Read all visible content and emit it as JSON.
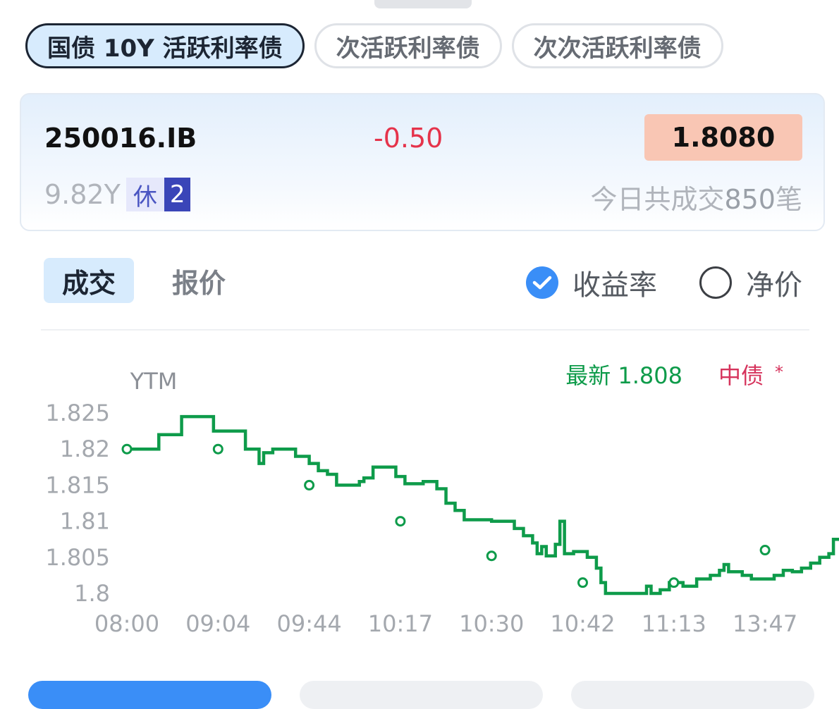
{
  "tabs": [
    {
      "label": "国债 10Y 活跃利率债",
      "active": true
    },
    {
      "label": "次活跃利率债",
      "active": false
    },
    {
      "label": "次次活跃利率债",
      "active": false
    }
  ],
  "bond": {
    "code": "250016.IB",
    "change": "-0.50",
    "price": "1.8080",
    "tenor": "9.82Y",
    "status_badge": "休",
    "status_count": "2",
    "deals_prefix": "今日共成交",
    "deals_count": "850",
    "deals_suffix": "笔"
  },
  "segments": {
    "trade": "成交",
    "quote": "报价"
  },
  "radios": {
    "yield": {
      "label": "收益率",
      "checked": true
    },
    "net_price": {
      "label": "净价",
      "checked": false
    }
  },
  "colors": {
    "line": "#0e9b4a",
    "down": "#e5334b",
    "accent": "#3a8ef7",
    "cdb": "#d6335c"
  },
  "legend": {
    "latest_label": "最新 1.808",
    "cdb_label": "中债",
    "cdb_star": "*"
  },
  "chart_data": {
    "type": "line",
    "ylabel": "YTM",
    "ylim": [
      1.8,
      1.825
    ],
    "yticks": [
      "1.825",
      "1.82",
      "1.815",
      "1.81",
      "1.805",
      "1.8"
    ],
    "xticks": [
      "08:00",
      "09:04",
      "09:44",
      "10:17",
      "10:30",
      "10:42",
      "11:13",
      "13:47"
    ],
    "series": [
      {
        "name": "成交",
        "step": true,
        "points": [
          [
            0.0,
            1.82
          ],
          [
            0.3,
            1.82
          ],
          [
            0.35,
            1.822
          ],
          [
            0.55,
            1.822
          ],
          [
            0.6,
            1.8245
          ],
          [
            0.9,
            1.8245
          ],
          [
            0.95,
            1.8225
          ],
          [
            1.1,
            1.8225
          ],
          [
            1.25,
            1.8225
          ],
          [
            1.3,
            1.82
          ],
          [
            1.45,
            1.818
          ],
          [
            1.5,
            1.8195
          ],
          [
            1.6,
            1.82
          ],
          [
            1.8,
            1.82
          ],
          [
            1.85,
            1.819
          ],
          [
            2.0,
            1.818
          ],
          [
            2.1,
            1.817
          ],
          [
            2.2,
            1.8165
          ],
          [
            2.3,
            1.815
          ],
          [
            2.5,
            1.815
          ],
          [
            2.55,
            1.8155
          ],
          [
            2.6,
            1.816
          ],
          [
            2.7,
            1.8175
          ],
          [
            2.9,
            1.8175
          ],
          [
            2.95,
            1.8162
          ],
          [
            3.05,
            1.8152
          ],
          [
            3.15,
            1.8152
          ],
          [
            3.25,
            1.8155
          ],
          [
            3.4,
            1.8145
          ],
          [
            3.5,
            1.8125
          ],
          [
            3.6,
            1.8115
          ],
          [
            3.7,
            1.8102
          ],
          [
            4.0,
            1.81
          ],
          [
            4.1,
            1.81
          ],
          [
            4.25,
            1.809
          ],
          [
            4.35,
            1.808
          ],
          [
            4.45,
            1.807
          ],
          [
            4.5,
            1.8055
          ],
          [
            4.55,
            1.8065
          ],
          [
            4.6,
            1.8052
          ],
          [
            4.7,
            1.8068
          ],
          [
            4.75,
            1.81
          ],
          [
            4.8,
            1.8055
          ],
          [
            4.9,
            1.8058
          ],
          [
            5.05,
            1.805
          ],
          [
            5.15,
            1.8035
          ],
          [
            5.2,
            1.8015
          ],
          [
            5.25,
            1.8
          ],
          [
            5.45,
            1.8
          ],
          [
            5.6,
            1.8
          ],
          [
            5.7,
            1.801
          ],
          [
            5.75,
            1.8
          ],
          [
            5.85,
            1.8005
          ],
          [
            5.95,
            1.8015
          ],
          [
            6.1,
            1.801
          ],
          [
            6.25,
            1.802
          ],
          [
            6.4,
            1.8025
          ],
          [
            6.5,
            1.8032
          ],
          [
            6.55,
            1.804
          ],
          [
            6.6,
            1.803
          ],
          [
            6.75,
            1.8025
          ],
          [
            6.85,
            1.802
          ],
          [
            7.0,
            1.802
          ],
          [
            7.1,
            1.8025
          ],
          [
            7.2,
            1.8032
          ],
          [
            7.3,
            1.803
          ],
          [
            7.4,
            1.8035
          ],
          [
            7.5,
            1.8042
          ],
          [
            7.6,
            1.805
          ],
          [
            7.7,
            1.8055
          ],
          [
            7.75,
            1.8075
          ],
          [
            7.85,
            1.807
          ],
          [
            7.95,
            1.806
          ],
          [
            8.05,
            1.805
          ],
          [
            8.15,
            1.805
          ],
          [
            8.25,
            1.807
          ],
          [
            8.35,
            1.8075
          ],
          [
            8.45,
            1.808
          ]
        ],
        "markers": [
          [
            0.0,
            1.82
          ],
          [
            1.0,
            1.82
          ],
          [
            2.0,
            1.815
          ],
          [
            3.0,
            1.81
          ],
          [
            4.0,
            1.8052
          ],
          [
            5.0,
            1.8015
          ],
          [
            6.0,
            1.8015
          ],
          [
            7.0,
            1.806
          ]
        ]
      }
    ]
  }
}
